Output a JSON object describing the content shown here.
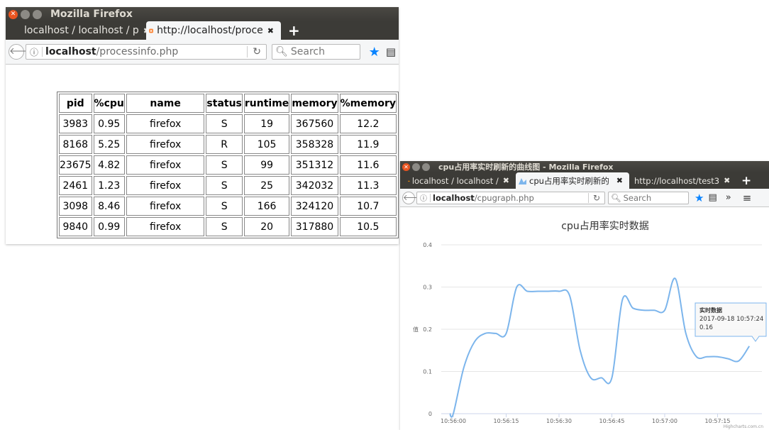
{
  "window1": {
    "title": "Mozilla Firefox",
    "tabs": [
      {
        "label": "localhost / localhost / p",
        "icon": "phpmyadmin-icon",
        "active": false
      },
      {
        "label": "http://localhost/proce",
        "icon": "xampp-icon",
        "active": true
      }
    ],
    "url_host": "localhost",
    "url_path": "/processinfo.php",
    "search_placeholder": "Search",
    "table": {
      "columns": [
        "pid",
        "%cpu",
        "name",
        "status",
        "runtime",
        "memory",
        "%memory"
      ],
      "rows": [
        [
          "3983",
          "0.95",
          "firefox",
          "S",
          "19",
          "367560",
          "12.2"
        ],
        [
          "8168",
          "5.25",
          "firefox",
          "R",
          "105",
          "358328",
          "11.9"
        ],
        [
          "23675",
          "4.82",
          "firefox",
          "S",
          "99",
          "351312",
          "11.6"
        ],
        [
          "2461",
          "1.23",
          "firefox",
          "S",
          "25",
          "342032",
          "11.3"
        ],
        [
          "3098",
          "8.46",
          "firefox",
          "S",
          "166",
          "324120",
          "10.7"
        ],
        [
          "9840",
          "0.99",
          "firefox",
          "S",
          "20",
          "317880",
          "10.5"
        ]
      ]
    }
  },
  "window2": {
    "title": "cpu占用率实时刷新的曲线图 - Mozilla Firefox",
    "tabs": [
      {
        "label": "localhost / localhost /",
        "icon": "phpmyadmin-icon",
        "active": false
      },
      {
        "label": "cpu占用率实时刷新的",
        "icon": "highcharts-icon",
        "active": true
      },
      {
        "label": "http://localhost/test3",
        "icon": "xampp-icon",
        "active": false
      }
    ],
    "url_host": "localhost",
    "url_path": "/cpugraph.php",
    "search_placeholder": "Search",
    "credits": "Highcharts.com.cn"
  },
  "chart_data": {
    "type": "line",
    "title": "cpu占用率实时数据",
    "ylabel": "值",
    "xlabel": "",
    "ylim": [
      0,
      0.4
    ],
    "yticks": [
      "0",
      "0.1",
      "0.2",
      "0.3",
      "0.4"
    ],
    "xticks": [
      "10:56:00",
      "10:56:15",
      "10:56:30",
      "10:56:45",
      "10:57:00",
      "10:57:15"
    ],
    "grid": true,
    "color": "#7cb5ec",
    "series": [
      {
        "x": [
          "10:55:59",
          "10:56:00",
          "10:56:03",
          "10:56:06",
          "10:56:09",
          "10:56:12",
          "10:56:15",
          "10:56:18",
          "10:56:21",
          "10:56:24",
          "10:56:27",
          "10:56:30",
          "10:56:33",
          "10:56:36",
          "10:56:39",
          "10:56:42",
          "10:56:45",
          "10:56:48",
          "10:56:51",
          "10:56:54",
          "10:56:57",
          "10:57:00",
          "10:57:03",
          "10:57:06",
          "10:57:09",
          "10:57:12",
          "10:57:15",
          "10:57:18",
          "10:57:21",
          "10:57:24"
        ],
        "values": [
          0,
          0,
          0.11,
          0.17,
          0.19,
          0.19,
          0.19,
          0.3,
          0.29,
          0.29,
          0.29,
          0.29,
          0.28,
          0.15,
          0.085,
          0.085,
          0.085,
          0.27,
          0.25,
          0.245,
          0.245,
          0.245,
          0.32,
          0.19,
          0.135,
          0.135,
          0.135,
          0.13,
          0.125,
          0.16
        ]
      }
    ],
    "tooltip": {
      "series_name": "实时数据",
      "time": "2017-09-18 10:57:24",
      "value": "0.16"
    }
  }
}
